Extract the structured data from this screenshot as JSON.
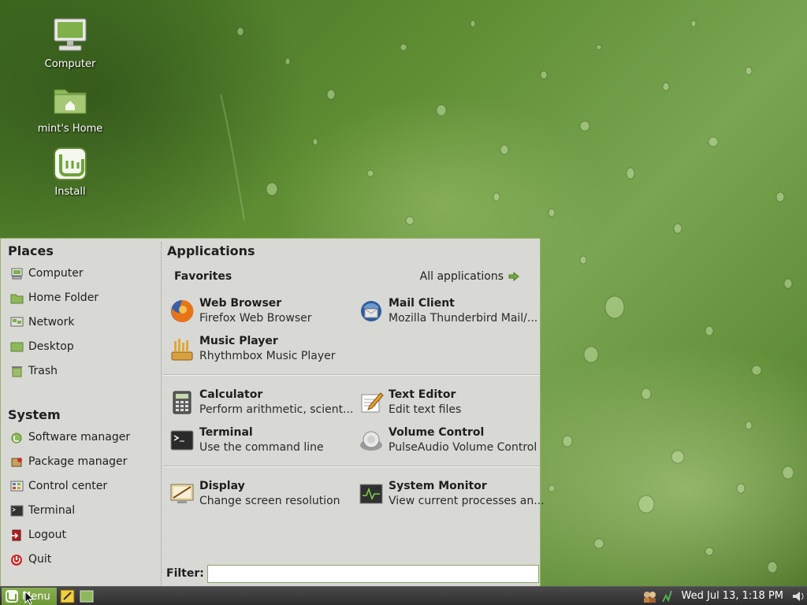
{
  "desktop": {
    "icons": [
      {
        "label": "Computer",
        "icon": "computer-icon"
      },
      {
        "label": "mint's Home",
        "icon": "home-folder-icon"
      },
      {
        "label": "Install",
        "icon": "mint-install-icon"
      }
    ]
  },
  "menu": {
    "places_title": "Places",
    "places": [
      {
        "label": "Computer",
        "icon": "computer-icon"
      },
      {
        "label": "Home Folder",
        "icon": "home-folder-icon"
      },
      {
        "label": "Network",
        "icon": "network-icon"
      },
      {
        "label": "Desktop",
        "icon": "desktop-icon"
      },
      {
        "label": "Trash",
        "icon": "trash-icon"
      }
    ],
    "system_title": "System",
    "system": [
      {
        "label": "Software manager",
        "icon": "software-manager-icon"
      },
      {
        "label": "Package manager",
        "icon": "package-manager-icon"
      },
      {
        "label": "Control center",
        "icon": "control-center-icon"
      },
      {
        "label": "Terminal",
        "icon": "terminal-icon"
      },
      {
        "label": "Logout",
        "icon": "logout-icon"
      },
      {
        "label": "Quit",
        "icon": "quit-icon"
      }
    ],
    "applications_title": "Applications",
    "favorites_title": "Favorites",
    "all_applications": "All applications",
    "apps": [
      {
        "name": "Web Browser",
        "desc": "Firefox Web Browser",
        "icon": "firefox-icon"
      },
      {
        "name": "Mail Client",
        "desc": "Mozilla Thunderbird Mail/...",
        "icon": "thunderbird-icon"
      },
      {
        "name": "Music Player",
        "desc": "Rhythmbox Music Player",
        "icon": "rhythmbox-icon"
      },
      {
        "name": "Calculator",
        "desc": "Perform arithmetic, scient...",
        "icon": "calculator-icon"
      },
      {
        "name": "Text Editor",
        "desc": "Edit text files",
        "icon": "text-editor-icon"
      },
      {
        "name": "Terminal",
        "desc": "Use the command line",
        "icon": "terminal-icon"
      },
      {
        "name": "Volume Control",
        "desc": "PulseAudio Volume Control",
        "icon": "volume-control-icon"
      },
      {
        "name": "Display",
        "desc": "Change screen resolution",
        "icon": "display-icon"
      },
      {
        "name": "System Monitor",
        "desc": "View current processes an...",
        "icon": "system-monitor-icon"
      }
    ],
    "filter_label": "Filter:",
    "filter_value": ""
  },
  "panel": {
    "menu_label": "Menu",
    "clock": "Wed Jul 13,  1:18 PM"
  },
  "colors": {
    "accent": "#7aa548",
    "menu_bg": "#d8d8d4",
    "panel_bg": "#3a3a3a"
  }
}
